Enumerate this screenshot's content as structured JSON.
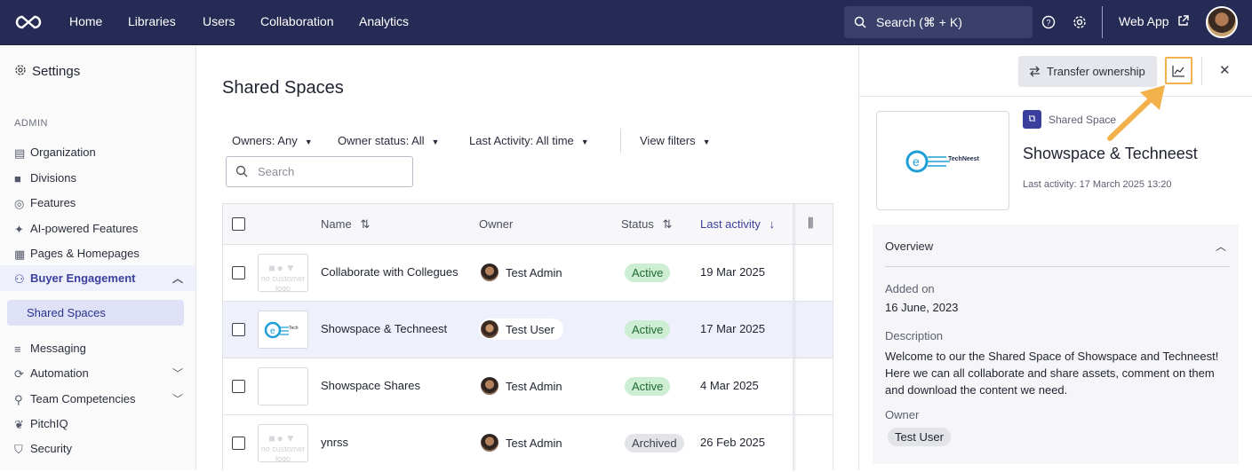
{
  "topbar": {
    "nav": [
      "Home",
      "Libraries",
      "Users",
      "Collaboration",
      "Analytics"
    ],
    "search_label": "Search (⌘ + K)",
    "webapp_label": "Web App"
  },
  "sidebar": {
    "title": "Settings",
    "section_label": "ADMIN",
    "items": [
      {
        "label": "Organization",
        "icon": "organization-icon"
      },
      {
        "label": "Divisions",
        "icon": "briefcase-icon"
      },
      {
        "label": "Features",
        "icon": "globe-icon"
      },
      {
        "label": "AI-powered Features",
        "icon": "sparkle-icon"
      },
      {
        "label": "Pages & Homepages",
        "icon": "layout-icon"
      },
      {
        "label": "Buyer Engagement",
        "icon": "people-icon"
      },
      {
        "label": "Messaging",
        "icon": "messaging-icon"
      },
      {
        "label": "Automation",
        "icon": "automation-icon"
      },
      {
        "label": "Team Competencies",
        "icon": "team-icon"
      },
      {
        "label": "PitchIQ",
        "icon": "brain-icon"
      },
      {
        "label": "Security",
        "icon": "shield-icon"
      }
    ],
    "sub_active": "Shared Spaces"
  },
  "main": {
    "title": "Shared Spaces",
    "filters": {
      "owners": "Owners: Any",
      "owner_status": "Owner status: All",
      "last_activity": "Last Activity: All time",
      "view_filters": "View filters"
    },
    "search_placeholder": "Search",
    "columns": {
      "name": "Name",
      "owner": "Owner",
      "status": "Status",
      "last_activity": "Last activity"
    },
    "nologo_text": "no customer logo",
    "rows": [
      {
        "name": "Collaborate with Collegues",
        "owner": "Test Admin",
        "status": "Active",
        "date": "19 Mar 2025"
      },
      {
        "name": "Showspace & Techneest",
        "owner": "Test User",
        "status": "Active",
        "date": "17 Mar 2025"
      },
      {
        "name": "Showspace Shares",
        "owner": "Test Admin",
        "status": "Active",
        "date": "4 Mar 2025"
      },
      {
        "name": "ynrss",
        "owner": "Test Admin",
        "status": "Archived",
        "date": "26 Feb 2025"
      }
    ]
  },
  "panel": {
    "transfer_label": "Transfer ownership",
    "type_label": "Shared Space",
    "name": "Showspace & Techneest",
    "last_activity": "Last activity: 17 March 2025 13:20",
    "logo_text": "TechNeest",
    "overview_title": "Overview",
    "added_label": "Added on",
    "added_value": "16 June, 2023",
    "description_label": "Description",
    "description": "Welcome to our the Shared Space of Showspace and Techneest! Here we can all collaborate and share assets, comment on them and download the content we need.",
    "owner_label": "Owner",
    "owner_value": "Test User"
  },
  "colors": {
    "topbar": "#262b55",
    "accent": "#3a3f9e",
    "highlight": "#f2b14a"
  }
}
